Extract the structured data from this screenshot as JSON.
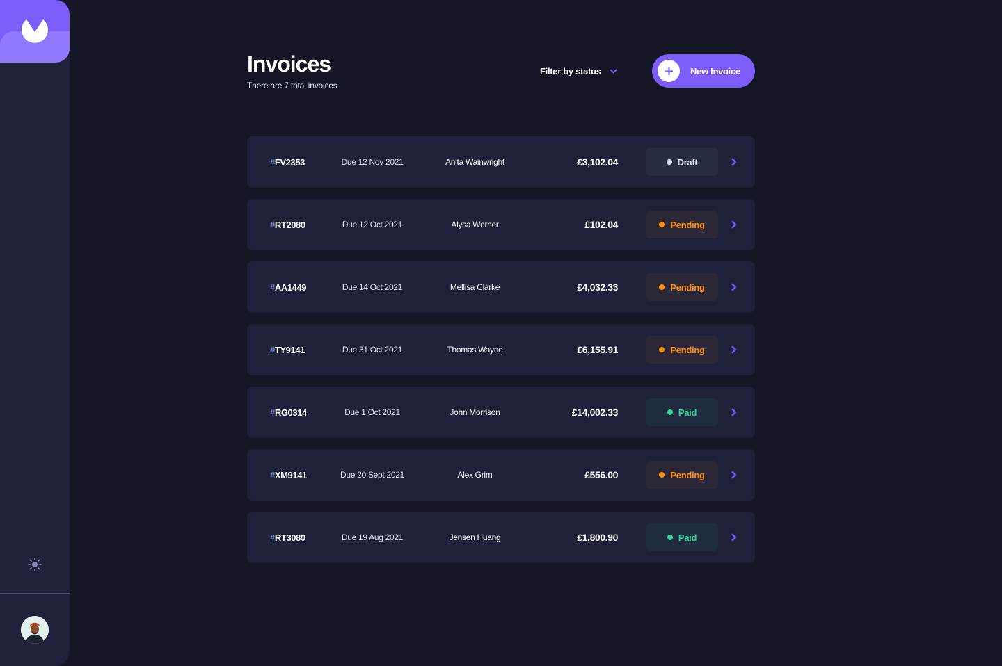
{
  "header": {
    "title": "Invoices",
    "subtitle": "There are 7 total invoices",
    "filter_label": "Filter by status",
    "new_button_label": "New Invoice"
  },
  "colors": {
    "background": "#141625",
    "surface": "#1e2139",
    "accent": "#7c5dfa",
    "accent_light": "#9277ff",
    "draft_text": "#dfe3fa",
    "draft_bg": "#292c45",
    "pending_text": "#ff8f00",
    "pending_bg": "#2b2736",
    "paid_text": "#33d69f",
    "paid_bg": "#1f2c3f"
  },
  "icons": {
    "logo": "logo-icon",
    "theme": "sun-icon",
    "filter": "chevron-down-icon",
    "new": "plus-icon",
    "row": "chevron-right-icon"
  },
  "invoices": [
    {
      "id_prefix": "#",
      "id": "FV2353",
      "due": "Due 12 Nov 2021",
      "client": "Anita Wainwright",
      "amount": "£3,102.04",
      "status": "Draft",
      "status_key": "draft"
    },
    {
      "id_prefix": "#",
      "id": "RT2080",
      "due": "Due 12 Oct 2021",
      "client": "Alysa Werner",
      "amount": "£102.04",
      "status": "Pending",
      "status_key": "pending"
    },
    {
      "id_prefix": "#",
      "id": "AA1449",
      "due": "Due 14 Oct 2021",
      "client": "Mellisa Clarke",
      "amount": "£4,032.33",
      "status": "Pending",
      "status_key": "pending"
    },
    {
      "id_prefix": "#",
      "id": "TY9141",
      "due": "Due 31 Oct 2021",
      "client": "Thomas Wayne",
      "amount": "£6,155.91",
      "status": "Pending",
      "status_key": "pending"
    },
    {
      "id_prefix": "#",
      "id": "RG0314",
      "due": "Due 1 Oct 2021",
      "client": "John Morrison",
      "amount": "£14,002.33",
      "status": "Paid",
      "status_key": "paid"
    },
    {
      "id_prefix": "#",
      "id": "XM9141",
      "due": "Due 20 Sept 2021",
      "client": "Alex Grim",
      "amount": "£556.00",
      "status": "Pending",
      "status_key": "pending"
    },
    {
      "id_prefix": "#",
      "id": "RT3080",
      "due": "Due 19 Aug 2021",
      "client": "Jensen Huang",
      "amount": "£1,800.90",
      "status": "Paid",
      "status_key": "paid"
    }
  ]
}
